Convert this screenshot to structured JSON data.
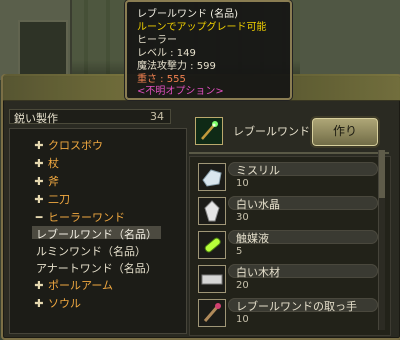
{
  "colors": {
    "category": "#f0a840",
    "tooltip_title": "#f2efe3",
    "tooltip_upgrade": "#f0d000",
    "tooltip_weight": "#f08050",
    "tooltip_unknown": "#e050c0"
  },
  "tooltip": {
    "title": "レブールワンド (名品)",
    "upgrade": "ルーンでアップグレード可能",
    "class": "ヒーラー",
    "level": "レベル : 149",
    "magic_attack": "魔法攻撃力 : 599",
    "weight": "重さ : 555",
    "option": "<不明オプション>"
  },
  "left": {
    "header_title": "鋭い製作",
    "header_count": "34",
    "items": [
      {
        "label": "クロスボウ",
        "type": "category",
        "icon": "plus-icon"
      },
      {
        "label": "杖",
        "type": "category",
        "icon": "plus-icon"
      },
      {
        "label": "斧",
        "type": "category",
        "icon": "plus-icon"
      },
      {
        "label": "二刀",
        "type": "category",
        "icon": "plus-icon"
      },
      {
        "label": "ヒーラーワンド",
        "type": "category-open",
        "icon": "minus-icon"
      },
      {
        "label": "レブールワンド（名品）",
        "type": "sub-selected"
      },
      {
        "label": "ルミンワンド（名品）",
        "type": "sub"
      },
      {
        "label": "アナートワンド（名品）",
        "type": "sub"
      },
      {
        "label": "ポールアーム",
        "type": "category",
        "icon": "plus-icon"
      },
      {
        "label": "ソウル",
        "type": "category",
        "icon": "plus-icon"
      }
    ]
  },
  "target": {
    "name": "レブールワンド",
    "icon": "wand-icon",
    "craft_label": "作り"
  },
  "materials": [
    {
      "name": "ミスリル",
      "count": "10",
      "icon": "mithril-icon"
    },
    {
      "name": "白い水晶",
      "count": "30",
      "icon": "crystal-icon"
    },
    {
      "name": "触媒液",
      "count": "5",
      "icon": "vial-icon"
    },
    {
      "name": "白い木材",
      "count": "20",
      "icon": "wood-icon"
    },
    {
      "name": "レブールワンドの取っ手",
      "count": "10",
      "icon": "handle-icon"
    }
  ]
}
